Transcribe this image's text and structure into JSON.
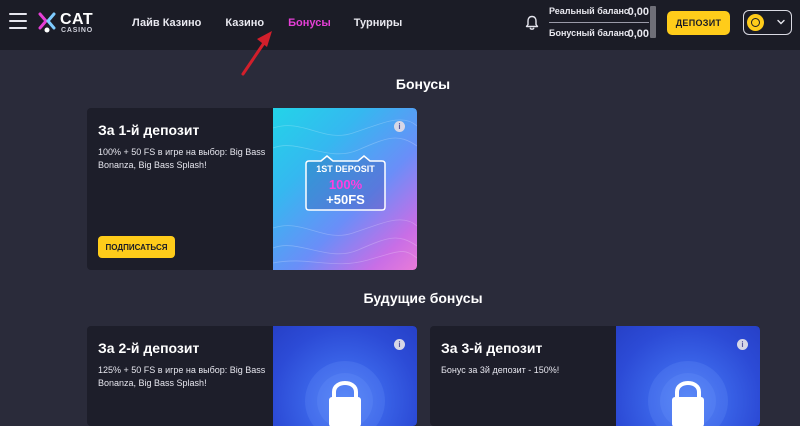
{
  "header": {
    "logo": {
      "name": "CAT",
      "sub": "CASINO"
    },
    "nav": [
      {
        "label": "Лайв Казино",
        "active": false
      },
      {
        "label": "Казино",
        "active": false
      },
      {
        "label": "Бонусы",
        "active": true
      },
      {
        "label": "Турниры",
        "active": false
      }
    ],
    "balance": {
      "real_label": "Реальный баланс",
      "real_value": "0,00",
      "bonus_label": "Бонусный баланс",
      "bonus_value": "0,00"
    },
    "deposit_label": "ДЕПОЗИТ",
    "icons": {
      "menu": "hamburger-icon",
      "bell": "bell-icon",
      "currency": "coin-icon",
      "chevron": "chevron-down-icon"
    }
  },
  "main": {
    "title": "Бонусы",
    "active_bonus": {
      "title": "За 1-й депозит",
      "description": "100% + 50 FS в игре на выбор: Big Bass Bonanza, Big Bass Splash!",
      "button": "ПОДПИСАТЬСЯ",
      "image_text": {
        "line1": "1ST DEPOSIT",
        "line2": "100%",
        "line3": "+50FS"
      }
    },
    "future_title": "Будущие бонусы",
    "future_bonuses": [
      {
        "title": "За 2-й депозит",
        "description": "125% + 50 FS в игре на выбор: Big Bass Bonanza, Big Bass Splash!"
      },
      {
        "title": "За 3-й депозит",
        "description": "Бонус за 3й депозит - 150%!"
      }
    ]
  },
  "colors": {
    "background": "#2a2b3a",
    "header": "#1b1c26",
    "card": "#1d1e2a",
    "accent_yellow": "#ffcc1a",
    "active_nav": "#e53fd6",
    "annotation_arrow": "#d21f2b"
  }
}
